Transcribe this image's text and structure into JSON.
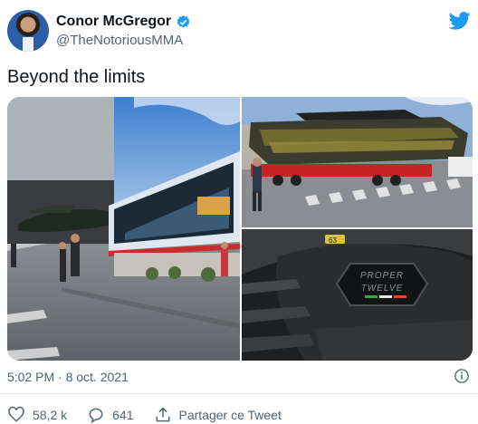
{
  "author": {
    "display_name": "Conor McGregor",
    "handle": "@TheNotoriousMMA",
    "verified_color": "#1d9bf0"
  },
  "tweet": {
    "text": "Beyond the limits",
    "timestamp": "5:02 PM · 8 oct. 2021"
  },
  "media": {
    "count": 3,
    "images": [
      {
        "description_icon": "photo-boat-hangar"
      },
      {
        "description_icon": "photo-boat-trailer"
      },
      {
        "description_icon": "photo-dashboard-badge"
      }
    ],
    "badge_text_line1": "PROPER",
    "badge_text_line2": "TWELVE",
    "hull_number": "63",
    "shed_number": "63"
  },
  "actions": {
    "likes": "58,2 k",
    "replies": "641",
    "share_label": "Partager ce Tweet"
  },
  "colors": {
    "twitter_blue": "#1d9bf0",
    "secondary_text": "#536471"
  }
}
